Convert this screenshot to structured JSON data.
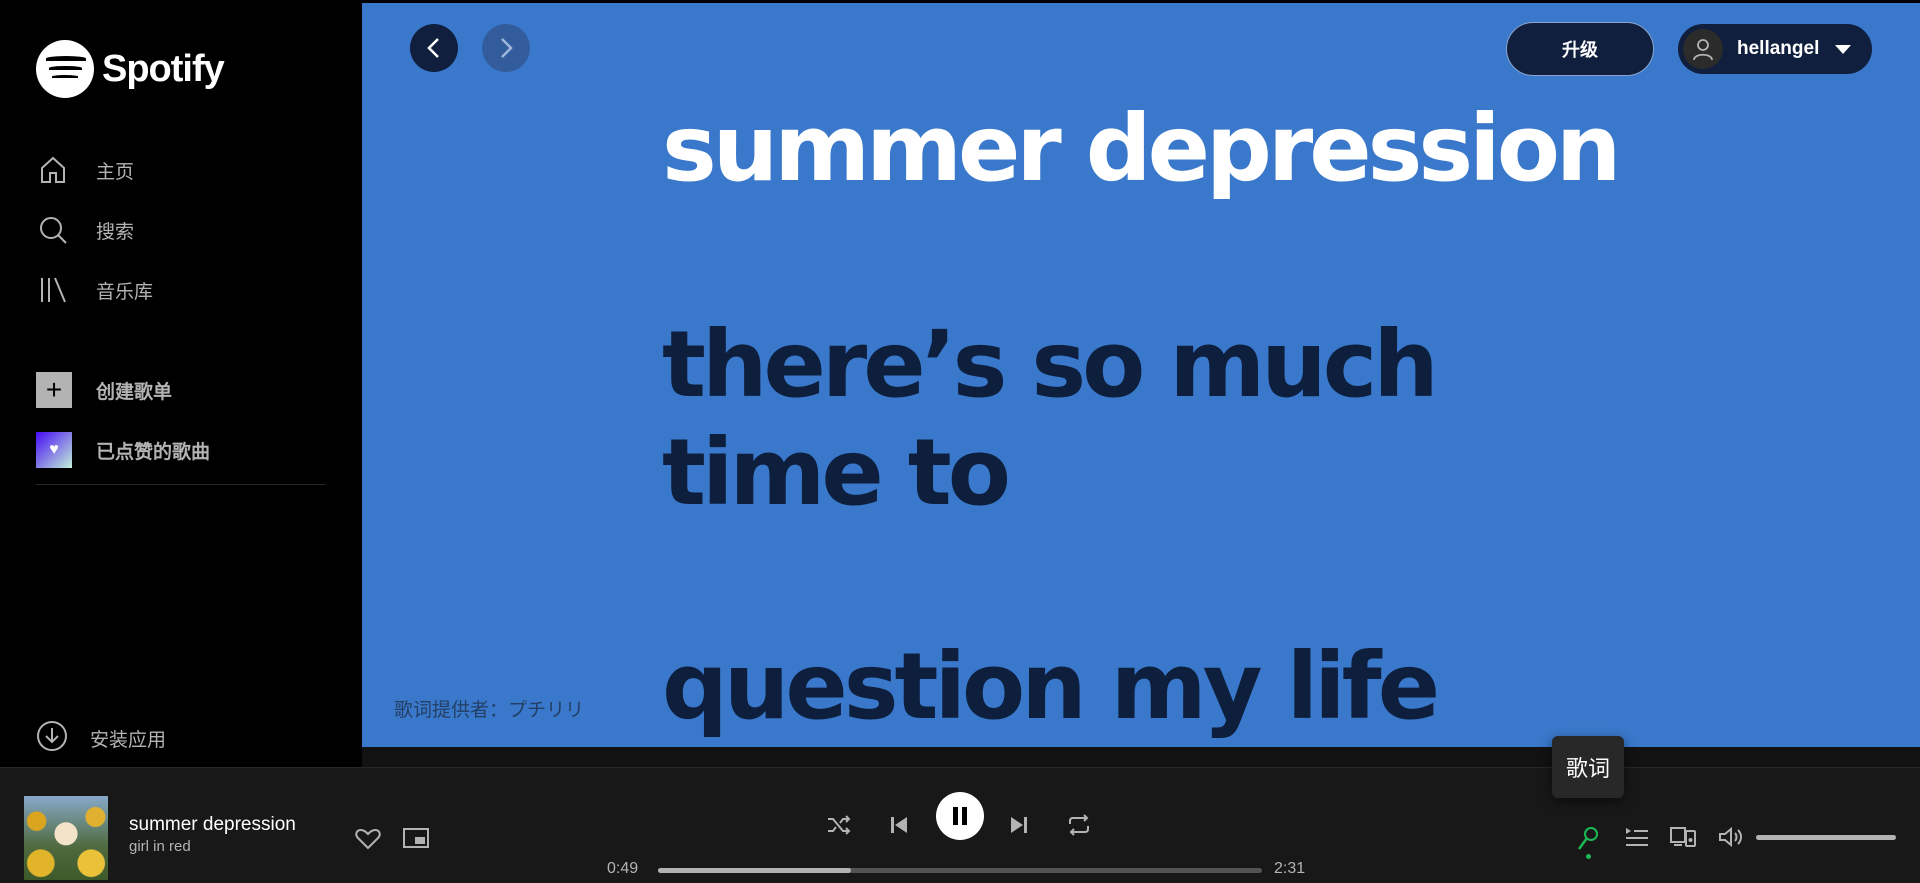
{
  "brand": {
    "name": "Spotify"
  },
  "sidebar": {
    "nav": [
      {
        "label": "主页",
        "icon": "home-icon"
      },
      {
        "label": "搜索",
        "icon": "search-icon"
      },
      {
        "label": "音乐库",
        "icon": "library-icon"
      }
    ],
    "actions": [
      {
        "label": "创建歌单",
        "icon": "plus-icon"
      },
      {
        "label": "已点赞的歌曲",
        "icon": "heart-icon"
      }
    ],
    "install_label": "安装应用"
  },
  "topbar": {
    "upgrade_label": "升级",
    "username": "hellangel"
  },
  "lyrics": {
    "lines": [
      "summer depression",
      "there’s so much time to",
      "question my life"
    ],
    "provider": "歌词提供者：プチリリ"
  },
  "player": {
    "track_title": "summer depression",
    "track_artist": "girl in red",
    "elapsed": "0:49",
    "duration": "2:31",
    "progress": 0.32,
    "volume": 1.0,
    "tooltip": "歌词"
  },
  "colors": {
    "lyrics_background": "#3a78cb",
    "active_lyric": "#ffffff",
    "upcoming_lyric": "#0d1f3d",
    "accent_green": "#1db954"
  }
}
